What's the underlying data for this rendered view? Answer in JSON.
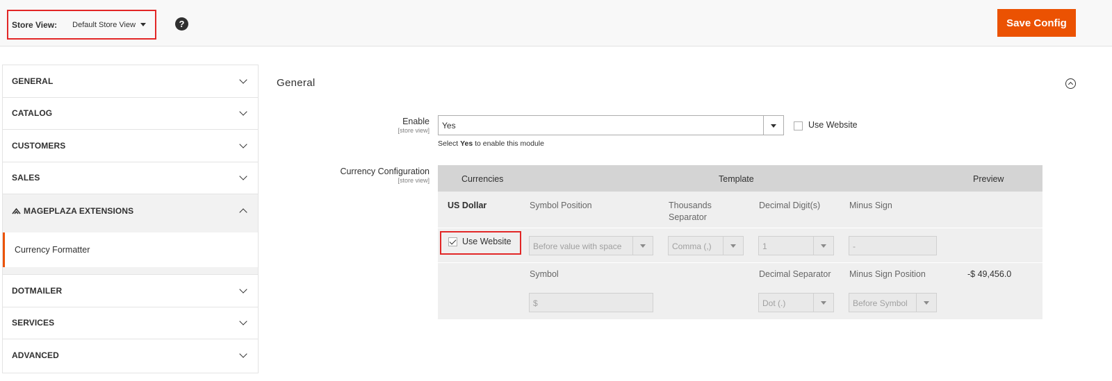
{
  "header": {
    "store_view_label": "Store View:",
    "store_view_value": "Default Store View",
    "help_icon": "question-icon",
    "save_label": "Save Config",
    "accent": "#eb5202"
  },
  "sidebar": {
    "items": [
      {
        "label": "GENERAL"
      },
      {
        "label": "CATALOG"
      },
      {
        "label": "CUSTOMERS"
      },
      {
        "label": "SALES"
      },
      {
        "label": "MAGEPLAZA EXTENSIONS"
      },
      {
        "label": "DOTMAILER"
      },
      {
        "label": "SERVICES"
      },
      {
        "label": "ADVANCED"
      }
    ],
    "sub_item": "Currency Formatter"
  },
  "main": {
    "section_title": "General",
    "enable": {
      "label": "Enable",
      "scope": "[store view]",
      "value": "Yes",
      "use_website": "Use Website",
      "note_prefix": "Select ",
      "note_bold": "Yes",
      "note_suffix": " to enable this module"
    },
    "currency": {
      "label": "Currency Configuration",
      "scope": "[store view]",
      "headers": {
        "currencies": "Currencies",
        "template": "Template",
        "preview": "Preview"
      },
      "currency_name": "US Dollar",
      "cols_row1": {
        "symbol_position": "Symbol Position",
        "thousands_separator_1": "Thousands",
        "thousands_separator_2": "Separator",
        "decimal_digits": "Decimal Digit(s)",
        "minus_sign": "Minus Sign"
      },
      "use_website": "Use Website",
      "values_row1": {
        "symbol_position": "Before value with space",
        "thousands_separator": "Comma (,)",
        "decimal_digits": "1",
        "minus_sign": "-"
      },
      "cols_row2": {
        "symbol": "Symbol",
        "decimal_separator": "Decimal Separator",
        "minus_sign_position": "Minus Sign Position"
      },
      "preview_value": "-$ 49,456.0",
      "values_row2": {
        "symbol": "$",
        "decimal_separator": "Dot (.)",
        "minus_sign_position": "Before Symbol"
      }
    }
  }
}
